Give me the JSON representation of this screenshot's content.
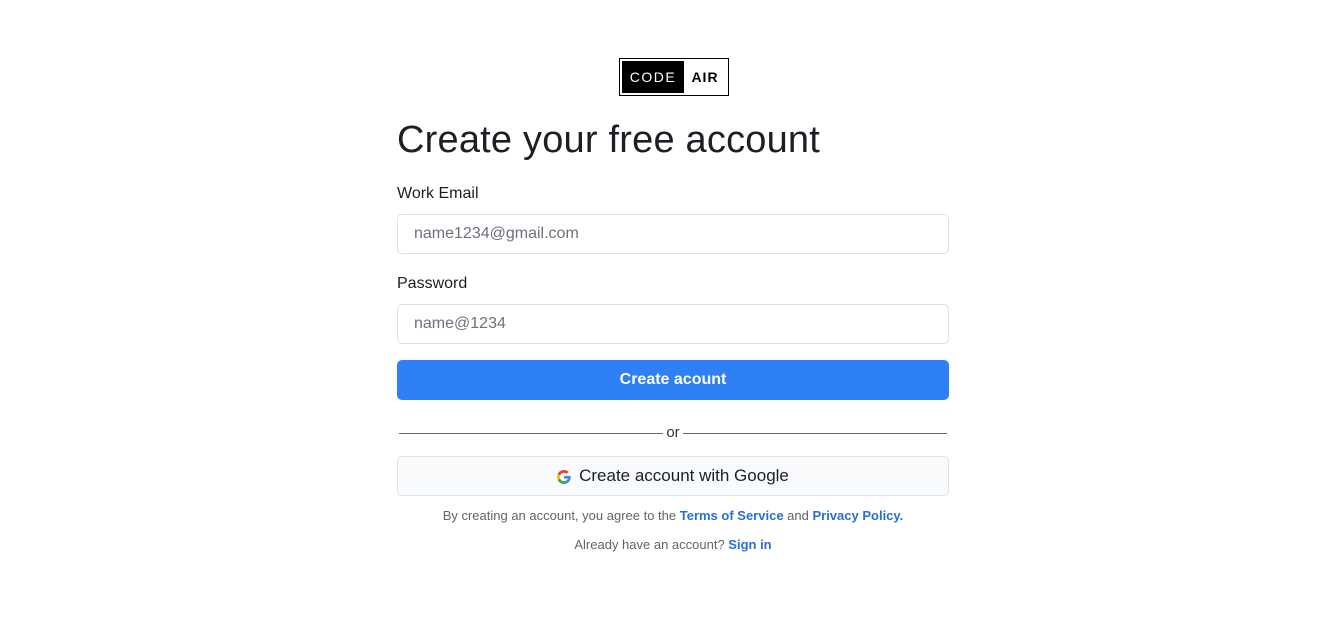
{
  "logo": {
    "left_text": "CODE",
    "right_text": "AIR"
  },
  "heading": "Create your free account",
  "email": {
    "label": "Work Email",
    "placeholder": "name1234@gmail.com"
  },
  "password": {
    "label": "Password",
    "placeholder": "name@1234"
  },
  "create_button": "Create acount",
  "divider_text": "or",
  "google_button": {
    "label": "Create account with Google",
    "icon": "google-icon"
  },
  "terms": {
    "prefix": "By creating an account, you agree to the ",
    "terms_link": "Terms of Service",
    "middle": " and ",
    "privacy_link": "Privacy Policy."
  },
  "signin": {
    "prefix": "Already have an account? ",
    "link": "Sign in"
  },
  "colors": {
    "primary": "#2f7ff5",
    "link": "#2b6fd6"
  }
}
